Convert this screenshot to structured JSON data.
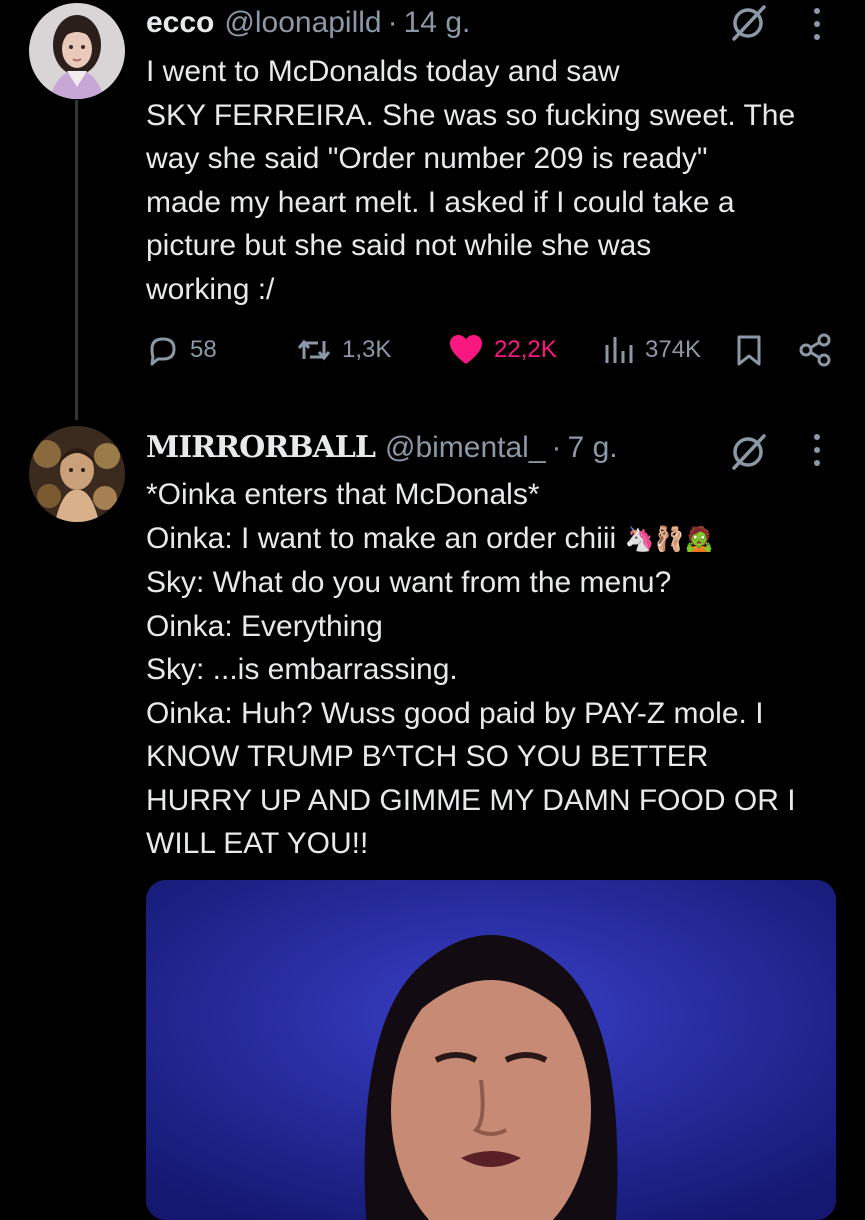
{
  "tweet1": {
    "name": "ecco",
    "handle": "@loonapilld",
    "separator": "·",
    "time": "14 g.",
    "lines": [
      "I went to McDonalds today and saw",
      "SKY FERREIRA. She was so fucking sweet. The",
      "way she said \"Order number 209 is ready\"",
      "made my heart melt. I asked if I could take a",
      "picture but she said not while she was",
      "working :/"
    ],
    "stats": {
      "replies": "58",
      "reposts": "1,3K",
      "likes": "22,2K",
      "views": "374K"
    }
  },
  "tweet2": {
    "name": "MIRRORBALL",
    "handle": "@bimental_",
    "separator": "·",
    "time": "7 g.",
    "lines": [
      "*Oinka enters that McDonals*",
      "Oinka: I want to make an order chiii",
      "Sky: What do you want from the menu?",
      "Oinka: Everything",
      "Sky: ...is embarrassing.",
      "Oinka: Huh? Wuss good paid by PAY-Z mole. I",
      "KNOW TRUMP B^TCH SO YOU BETTER",
      "HURRY UP AND GIMME MY DAMN FOOD OR I",
      "WILL EAT YOU!!"
    ],
    "emojis": [
      "🦄",
      "🩰",
      "🧟"
    ]
  },
  "icons": {
    "reply": "reply-icon",
    "repost": "repost-icon",
    "like": "heart-icon",
    "views": "views-icon",
    "bookmark": "bookmark-icon",
    "share": "share-icon",
    "grok": "grok-icon",
    "more": "more-icon"
  },
  "colors": {
    "background": "#000000",
    "text": "#e7e9ea",
    "secondary": "#8b98a5",
    "like": "#f91880",
    "media_bg": "#1a1e8c"
  }
}
